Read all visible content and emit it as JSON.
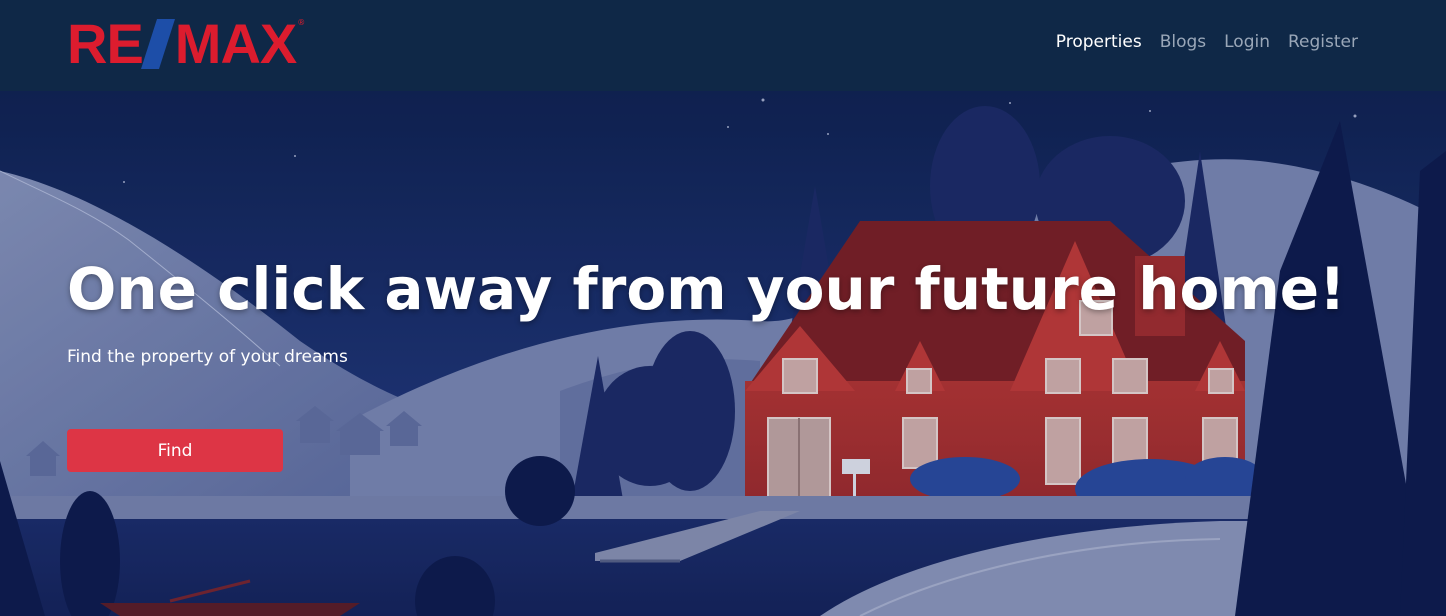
{
  "brand": {
    "logo_text_left": "RE",
    "logo_text_right": "MAX",
    "registered_mark": "®",
    "colors": {
      "red": "#dc1c2e",
      "blue": "#1d4ea8"
    }
  },
  "nav": {
    "items": [
      {
        "label": "Properties",
        "active": true
      },
      {
        "label": "Blogs",
        "active": false
      },
      {
        "label": "Login",
        "active": false
      },
      {
        "label": "Register",
        "active": false
      }
    ]
  },
  "hero": {
    "headline": "One click away from your future home!",
    "subheadline": "Find the property of your dreams",
    "cta_label": "Find",
    "cta_color": "#dd3545"
  }
}
